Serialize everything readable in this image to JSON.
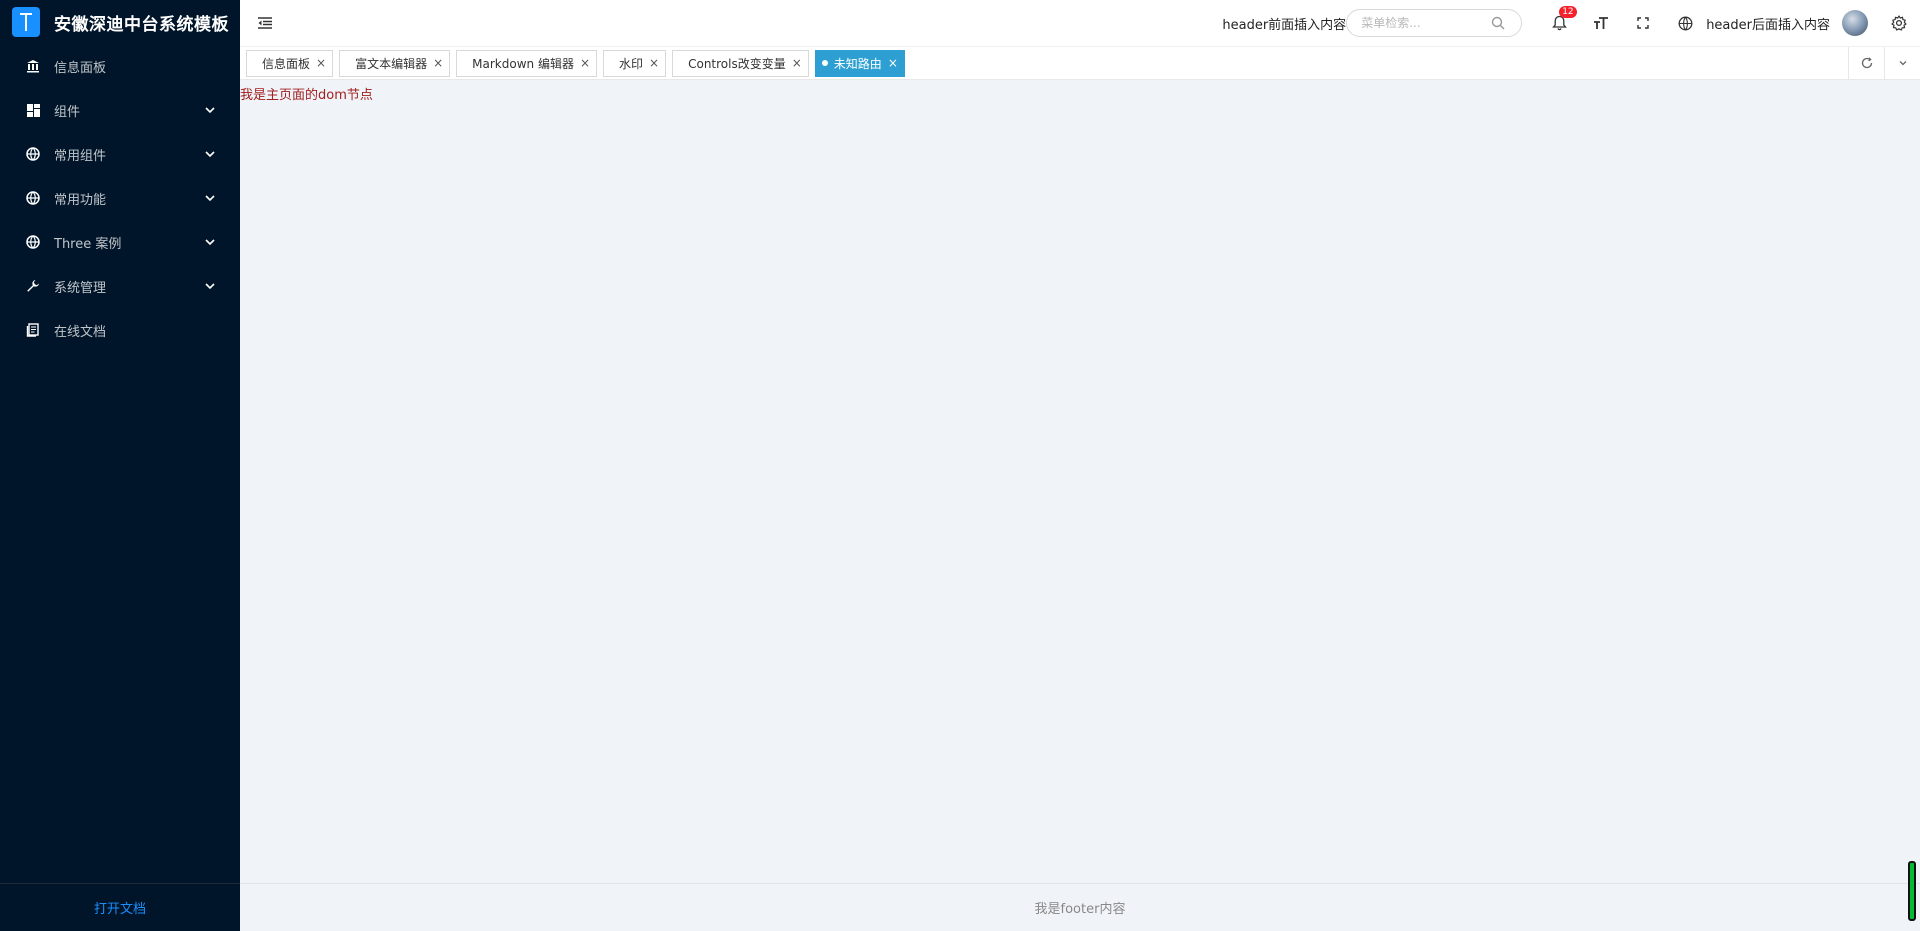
{
  "app": {
    "title": "安徽深迪中台系统模板"
  },
  "sidebar": {
    "items": [
      {
        "label": "信息面板",
        "icon": "bank-icon",
        "expandable": false
      },
      {
        "label": "组件",
        "icon": "dashboard-icon",
        "expandable": true
      },
      {
        "label": "常用组件",
        "icon": "globe-icon",
        "expandable": true
      },
      {
        "label": "常用功能",
        "icon": "globe-icon",
        "expandable": true
      },
      {
        "label": "Three 案例",
        "icon": "globe-icon",
        "expandable": true
      },
      {
        "label": "系统管理",
        "icon": "wrench-icon",
        "expandable": true
      },
      {
        "label": "在线文档",
        "icon": "document-icon",
        "expandable": false
      }
    ],
    "footer_link": "打开文档"
  },
  "header": {
    "before_text": "header前面插入内容",
    "search_placeholder": "菜单检索...",
    "notification_count": "12",
    "after_text": "header后面插入内容"
  },
  "tabs": [
    {
      "label": "信息面板",
      "active": false
    },
    {
      "label": "富文本编辑器",
      "active": false
    },
    {
      "label": "Markdown 编辑器",
      "active": false
    },
    {
      "label": "水印",
      "active": false
    },
    {
      "label": "Controls改变变量",
      "active": false
    },
    {
      "label": "未知路由",
      "active": true
    }
  ],
  "tab_close_glyph": "×",
  "main": {
    "dom_text": "我是主页面的dom节点"
  },
  "footer": {
    "text": "我是footer内容"
  },
  "colors": {
    "sidebar_bg": "#001529",
    "accent": "#1890ff",
    "active_tab": "#2d9fd3",
    "badge": "#f5222d"
  }
}
